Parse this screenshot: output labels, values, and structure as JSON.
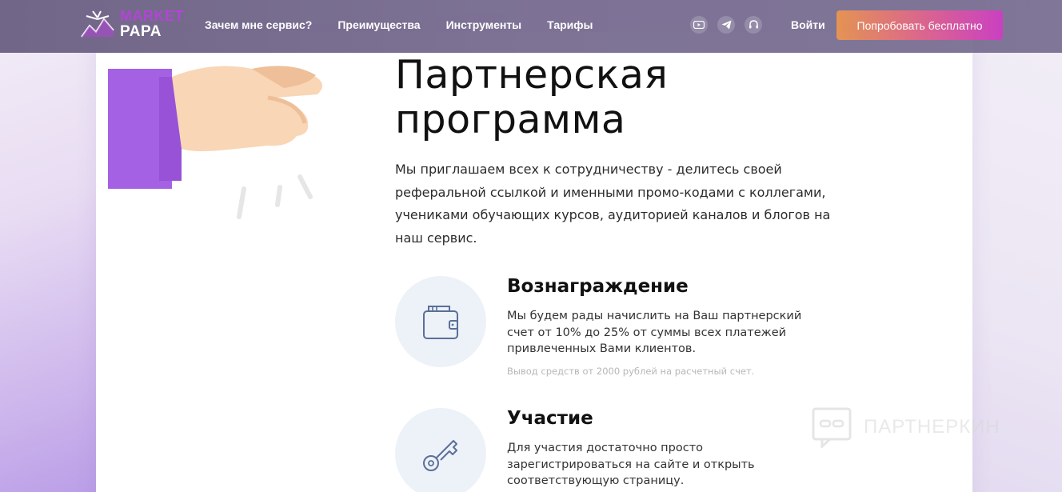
{
  "header": {
    "logo": {
      "line1": "MARKET",
      "line2": "PAPA"
    },
    "nav": [
      {
        "label": "Зачем мне сервис?"
      },
      {
        "label": "Преимущества"
      },
      {
        "label": "Инструменты"
      },
      {
        "label": "Тарифы"
      }
    ],
    "social_icons": [
      "youtube-icon",
      "telegram-icon",
      "headset-icon"
    ],
    "login_label": "Войти",
    "cta_label": "Попробовать бесплатно"
  },
  "hero": {
    "title_line1": "Партнерская",
    "title_line2": "программа",
    "intro": "Мы приглашаем всех к сотрудничеству - делитесь своей реферальной ссылкой и именными промо-кодами с коллегами, учениками обучающих курсов, аудиторией каналов и блогов на наш сервис."
  },
  "features": [
    {
      "icon": "wallet-icon",
      "title": "Вознаграждение",
      "desc": "Мы будем рады начислить на Ваш партнерский счет от 10% до 25% от суммы всех платежей привлеченных Вами клиентов.",
      "note": "Вывод средств от 2000 рублей на расчетный счет."
    },
    {
      "icon": "key-icon",
      "title": "Участие",
      "desc": "Для участия достаточно просто зарегистрироваться на сайте и открыть соответствующую страницу."
    }
  ],
  "watermark": "ПАРТНЕРКИН",
  "colors": {
    "header_bg": "#74698c",
    "logo_accent": "#b13fd6",
    "cta_gradient_start": "#e4914f",
    "cta_gradient_end": "#c93bc0",
    "icon_circle_bg": "#edf1f8",
    "icon_stroke": "#5a6f98"
  }
}
